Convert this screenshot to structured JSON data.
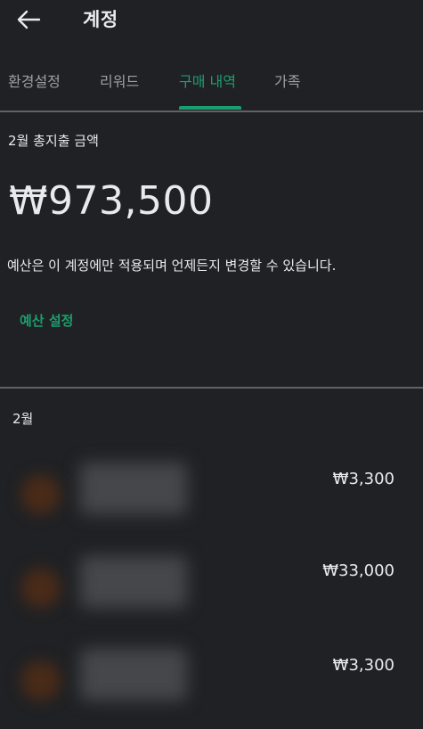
{
  "header": {
    "title": "계정",
    "back_icon": "arrow-back-icon"
  },
  "tabs": [
    {
      "label": "환경설정",
      "active": false
    },
    {
      "label": "리워드",
      "active": false
    },
    {
      "label": "구매 내역",
      "active": true
    },
    {
      "label": "가족",
      "active": false
    }
  ],
  "summary": {
    "label": "2월 총지출 금액",
    "amount": "₩973,500",
    "note": "예산은 이 계정에만 적용되며 언제든지 변경할 수 있습니다.",
    "budget_link": "예산 설정"
  },
  "purchases": {
    "month": "2월",
    "items": [
      {
        "price": "₩3,300"
      },
      {
        "price": "₩33,000"
      },
      {
        "price": "₩3,300"
      }
    ]
  },
  "colors": {
    "background": "#202124",
    "accent": "#1b9e6e",
    "text": "#e8eaed",
    "muted": "#9aa0a6"
  }
}
